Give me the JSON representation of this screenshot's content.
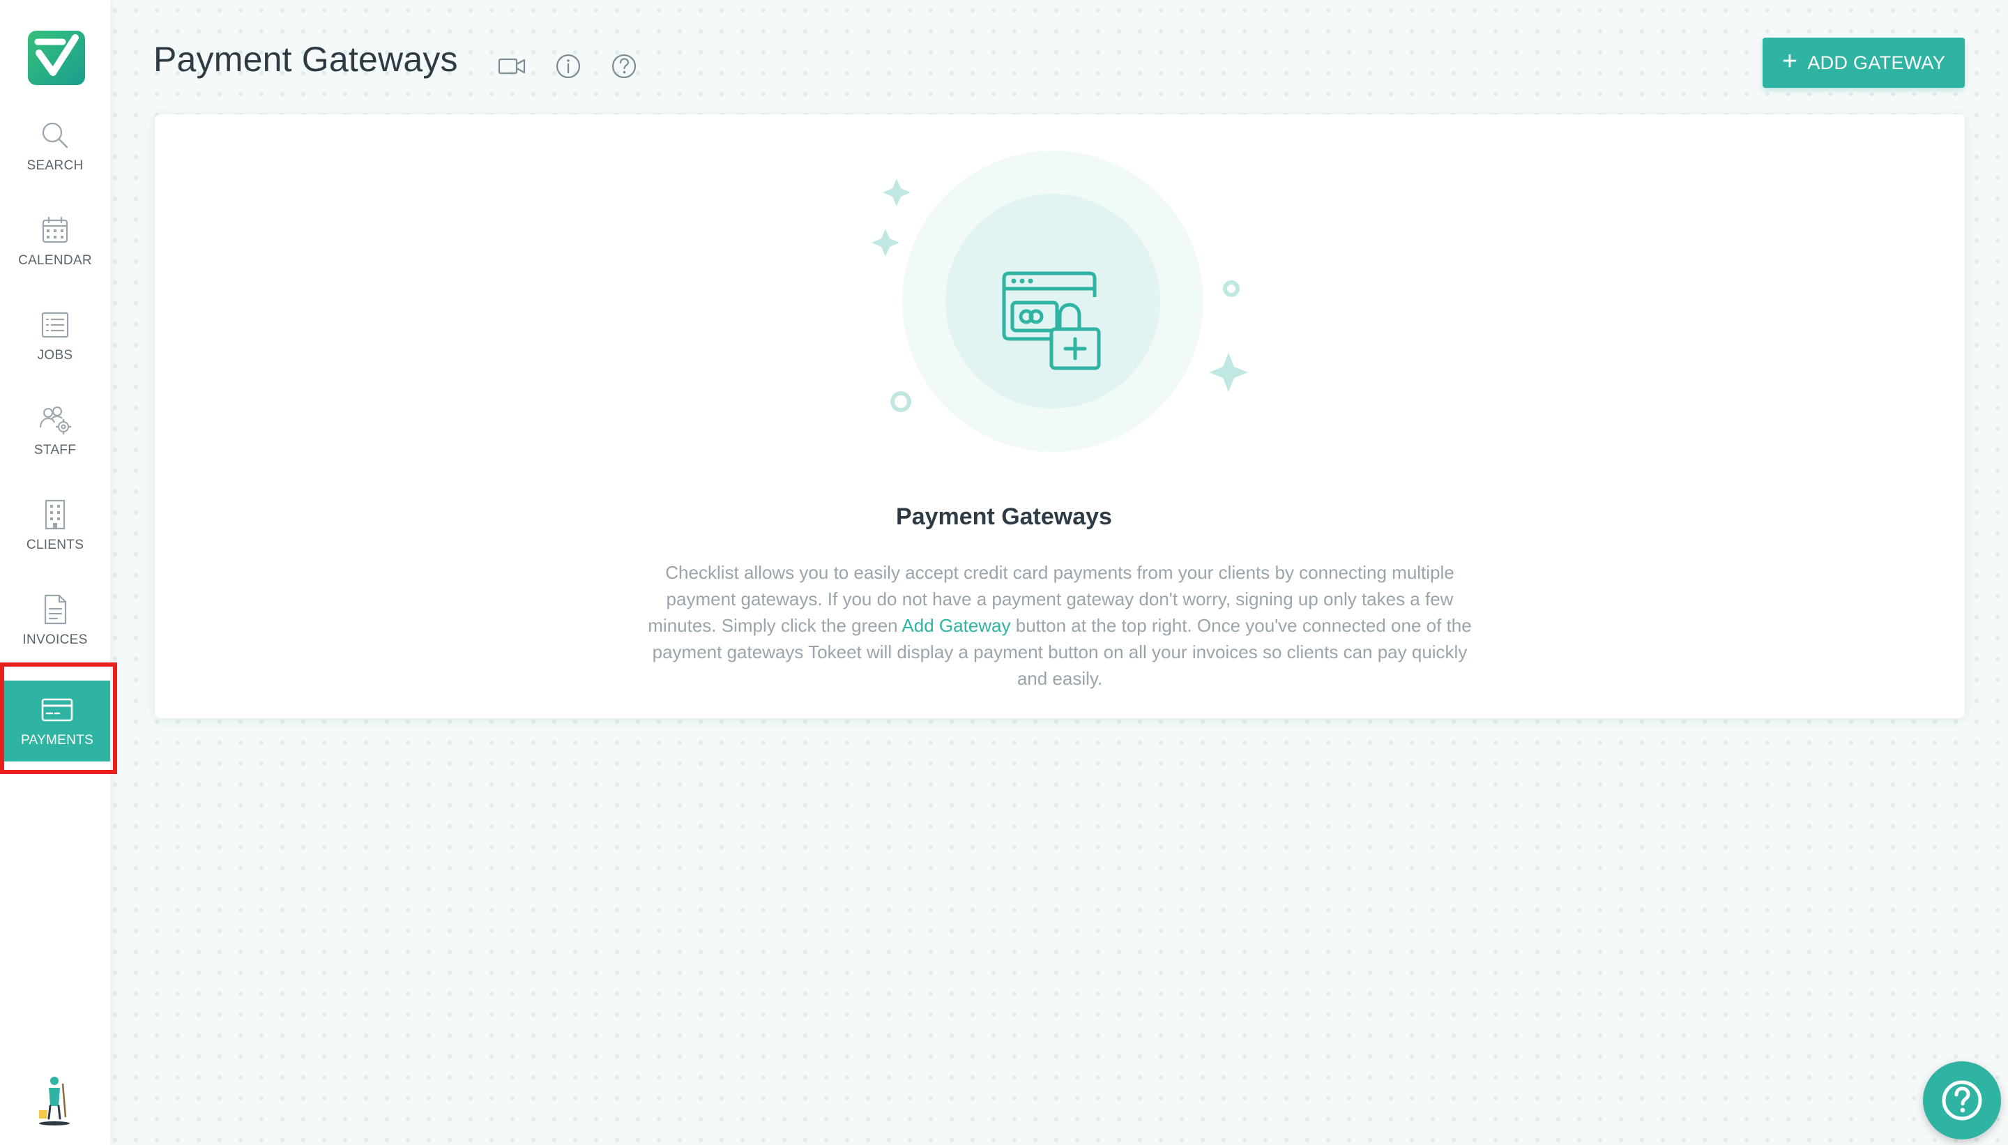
{
  "sidebar": {
    "items": [
      {
        "label": "SEARCH",
        "icon": "search-icon"
      },
      {
        "label": "CALENDAR",
        "icon": "calendar-icon"
      },
      {
        "label": "JOBS",
        "icon": "list-icon"
      },
      {
        "label": "STAFF",
        "icon": "staff-gear-icon"
      },
      {
        "label": "CLIENTS",
        "icon": "building-icon"
      },
      {
        "label": "INVOICES",
        "icon": "document-icon"
      },
      {
        "label": "PAYMENTS",
        "icon": "credit-card-icon",
        "active": true
      }
    ]
  },
  "header": {
    "title": "Payment Gateways",
    "icons": [
      "video-icon",
      "info-icon",
      "question-icon"
    ],
    "add_button_label": "ADD GATEWAY"
  },
  "empty_state": {
    "title": "Payment Gateways",
    "description_before": "Checklist allows you to easily accept credit card payments from your clients by connecting multiple payment gateways. If you do not have a payment gateway don't worry, signing up only takes a few minutes. Simply click the green ",
    "link_text": "Add Gateway",
    "description_after": " button at the top right. Once you've connected one of the payment gateways Tokeet will display a payment button on all your invoices so clients can pay quickly and easily.",
    "illustration_icon": "secure-payment-lock-icon"
  },
  "colors": {
    "accent": "#2fb3a3",
    "highlight_border": "#e8201d",
    "title_text": "#2f3b44",
    "muted_text": "#9aa5ab"
  }
}
